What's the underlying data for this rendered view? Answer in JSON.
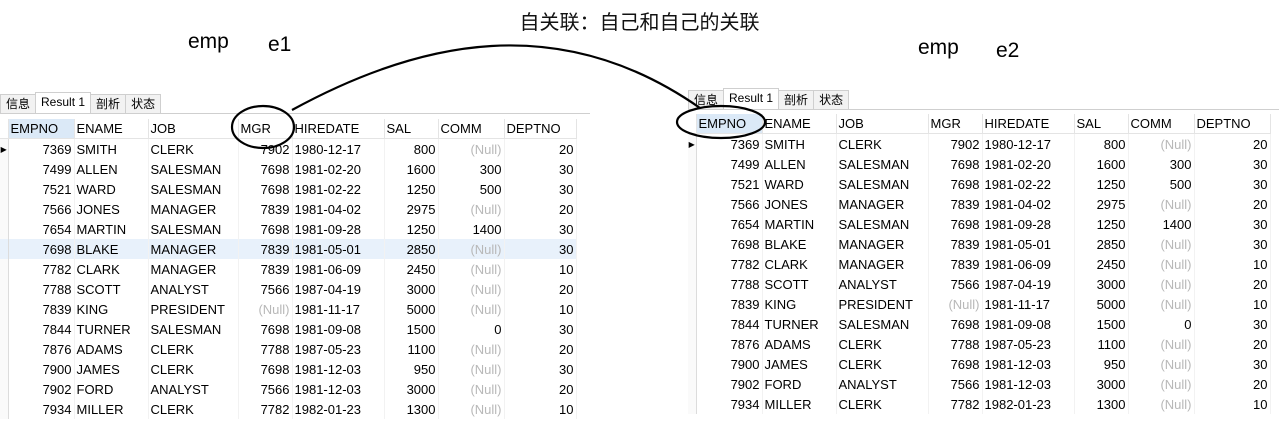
{
  "title": "自关联：自己和自己的关联",
  "left_labels": {
    "table": "emp",
    "alias": "e1"
  },
  "right_labels": {
    "table": "emp",
    "alias": "e2"
  },
  "tabs": [
    "信息",
    "Result 1",
    "剖析",
    "状态"
  ],
  "columns": [
    "EMPNO",
    "ENAME",
    "JOB",
    "MGR",
    "HIREDATE",
    "SAL",
    "COMM",
    "DEPTNO"
  ],
  "null_text": "(Null)",
  "rows": [
    [
      "7369",
      "SMITH",
      "CLERK",
      "7902",
      "1980-12-17",
      "800",
      "(Null)",
      "20"
    ],
    [
      "7499",
      "ALLEN",
      "SALESMAN",
      "7698",
      "1981-02-20",
      "1600",
      "300",
      "30"
    ],
    [
      "7521",
      "WARD",
      "SALESMAN",
      "7698",
      "1981-02-22",
      "1250",
      "500",
      "30"
    ],
    [
      "7566",
      "JONES",
      "MANAGER",
      "7839",
      "1981-04-02",
      "2975",
      "(Null)",
      "20"
    ],
    [
      "7654",
      "MARTIN",
      "SALESMAN",
      "7698",
      "1981-09-28",
      "1250",
      "1400",
      "30"
    ],
    [
      "7698",
      "BLAKE",
      "MANAGER",
      "7839",
      "1981-05-01",
      "2850",
      "(Null)",
      "30"
    ],
    [
      "7782",
      "CLARK",
      "MANAGER",
      "7839",
      "1981-06-09",
      "2450",
      "(Null)",
      "10"
    ],
    [
      "7788",
      "SCOTT",
      "ANALYST",
      "7566",
      "1987-04-19",
      "3000",
      "(Null)",
      "20"
    ],
    [
      "7839",
      "KING",
      "PRESIDENT",
      "(Null)",
      "1981-11-17",
      "5000",
      "(Null)",
      "10"
    ],
    [
      "7844",
      "TURNER",
      "SALESMAN",
      "7698",
      "1981-09-08",
      "1500",
      "0",
      "30"
    ],
    [
      "7876",
      "ADAMS",
      "CLERK",
      "7788",
      "1987-05-23",
      "1100",
      "(Null)",
      "20"
    ],
    [
      "7900",
      "JAMES",
      "CLERK",
      "7698",
      "1981-12-03",
      "950",
      "(Null)",
      "30"
    ],
    [
      "7902",
      "FORD",
      "ANALYST",
      "7566",
      "1981-12-03",
      "3000",
      "(Null)",
      "20"
    ],
    [
      "7934",
      "MILLER",
      "CLERK",
      "7782",
      "1982-01-23",
      "1300",
      "(Null)",
      "10"
    ]
  ],
  "colors": {
    "annotation": "#000000",
    "null": "#b8b8b8",
    "selected_row": "#e8f1fb"
  }
}
